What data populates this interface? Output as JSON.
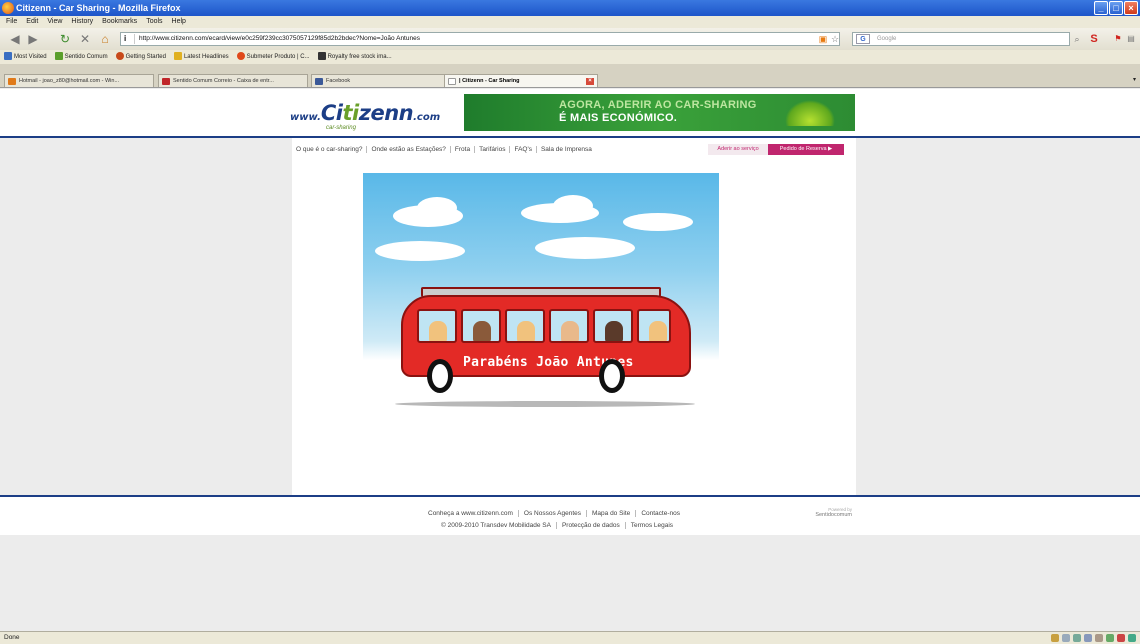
{
  "window": {
    "title": "Citizenn - Car Sharing - Mozilla Firefox"
  },
  "menu": [
    "File",
    "Edit",
    "View",
    "History",
    "Bookmarks",
    "Tools",
    "Help"
  ],
  "toolbar": {
    "url": "http://www.citizenn.com/ecard/view/e0c259f239cc3075057129f85d2b2bdec?Nome=João Antunes",
    "search_placeholder": "Google"
  },
  "bookmarks": [
    "Most Visited",
    "Sentido Comum",
    "Getting Started",
    "Latest Headlines",
    "Submeter Produto | C...",
    "Royalty free stock ima..."
  ],
  "tabs": [
    {
      "label": "Hotmail - joao_z80@hotmail.com - Win..."
    },
    {
      "label": "Sentido Comum Correio - Caixa de entr..."
    },
    {
      "label": "Facebook"
    },
    {
      "label": "| Citizenn - Car Sharing"
    }
  ],
  "header": {
    "logo_www": "www.",
    "logo_brand_1": "Ci",
    "logo_brand_accent": "ti",
    "logo_brand_2": "zenn",
    "logo_com": ".com",
    "logo_tag": "car-sharing",
    "banner_line1": "AGORA, ADERIR AO CAR-SHARING",
    "banner_line2": "É MAIS ECONÓMICO."
  },
  "nav": {
    "items": [
      "O que é o car-sharing?",
      "Onde estão as Estações?",
      "Frota",
      "Tarifários",
      "FAQ's",
      "Sala de Imprensa"
    ],
    "aderir": "Aderir ao serviço",
    "reserva": "Pedido de Reserva ▶"
  },
  "ecard": {
    "message": "Parabéns João Antunes"
  },
  "footer": {
    "row1": [
      "Conheça a www.citizenn.com",
      "Os Nossos Agentes",
      "Mapa do Site",
      "Contacte-nos"
    ],
    "row2": [
      "© 2009-2010 Transdev Mobilidade SA",
      "Protecção de dados",
      "Termos Legais"
    ],
    "powered_label": "Powered by",
    "powered_brand": "Sentidocomum"
  },
  "status": {
    "text": "Done"
  },
  "colors": {
    "brand_blue": "#1c3e86",
    "brand_green": "#6aa02a",
    "accent_pink": "#c0266e",
    "bus_red": "#e32a26"
  }
}
